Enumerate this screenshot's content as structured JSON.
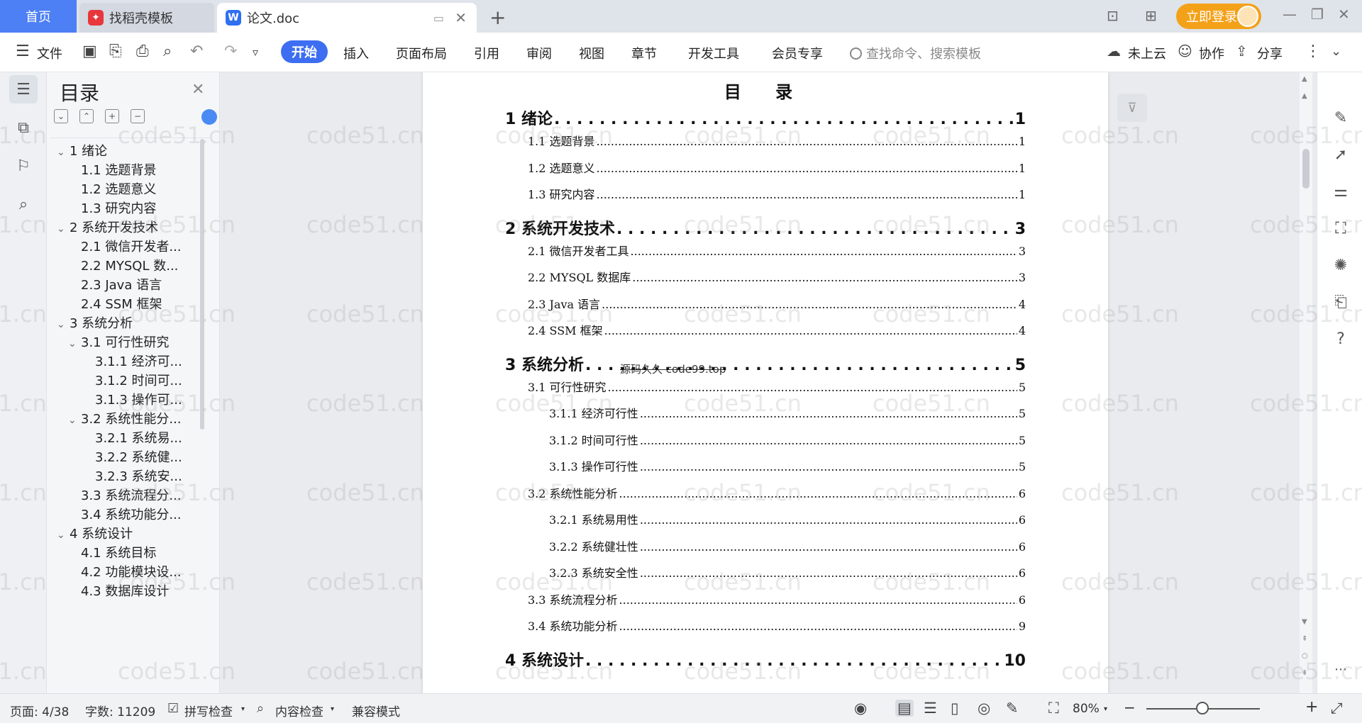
{
  "tabs": {
    "home": "首页",
    "tab1": {
      "label": "找稻壳模板",
      "icon": "docer-logo-icon"
    },
    "tab2": {
      "label": "论文.doc",
      "icon": "wps-writer-logo-icon"
    },
    "login": "立即登录"
  },
  "ribbon": {
    "file": "文件",
    "tabs": [
      "开始",
      "插入",
      "页面布局",
      "引用",
      "审阅",
      "视图",
      "章节",
      "开发工具",
      "会员专享"
    ],
    "search_placeholder": "查找命令、搜索模板",
    "cloud": "未上云",
    "collab": "协作",
    "share": "分享"
  },
  "toc_panel": {
    "title": "目录",
    "items": [
      {
        "label": "1  绪论",
        "expanded": true,
        "level": 1
      },
      {
        "label": "1.1  选题背景",
        "level": 2
      },
      {
        "label": "1.2  选题意义",
        "level": 2
      },
      {
        "label": "1.3  研究内容",
        "level": 2
      },
      {
        "label": "2  系统开发技术",
        "expanded": true,
        "level": 1
      },
      {
        "label": "2.1 微信开发者...",
        "level": 2
      },
      {
        "label": "2.2 MYSQL 数...",
        "level": 2
      },
      {
        "label": "2.3 Java 语言",
        "level": 2
      },
      {
        "label": "2.4 SSM 框架",
        "level": 2
      },
      {
        "label": "3  系统分析",
        "expanded": true,
        "level": 1
      },
      {
        "label": "3.1 可行性研究",
        "expanded": true,
        "level": 2
      },
      {
        "label": "3.1.1 经济可...",
        "level": 3
      },
      {
        "label": "3.1.2 时间可...",
        "level": 3
      },
      {
        "label": "3.1.3 操作可...",
        "level": 3
      },
      {
        "label": "3.2 系统性能分...",
        "expanded": true,
        "level": 2
      },
      {
        "label": "3.2.1 系统易...",
        "level": 3
      },
      {
        "label": "3.2.2 系统健...",
        "level": 3
      },
      {
        "label": "3.2.3 系统安...",
        "level": 3
      },
      {
        "label": "3.3  系统流程分...",
        "level": 2
      },
      {
        "label": "3.4 系统功能分...",
        "level": 2
      },
      {
        "label": "4  系统设计",
        "expanded": true,
        "level": 1
      },
      {
        "label": "4.1 系统目标",
        "level": 2
      },
      {
        "label": "4.2 功能模块设...",
        "level": 2
      },
      {
        "label": "4.3 数据库设计",
        "level": 2
      }
    ]
  },
  "document": {
    "title": "目 录",
    "inline_watermark": "源码久久 code99.top",
    "lines": [
      {
        "text": "1  绪论",
        "page": "1",
        "level": 1
      },
      {
        "text": "1.1  选题背景",
        "page": "1",
        "level": 2
      },
      {
        "text": "1.2  选题意义",
        "page": "1",
        "level": 2
      },
      {
        "text": "1.3  研究内容",
        "page": "1",
        "level": 2
      },
      {
        "text": "2  系统开发技术",
        "page": "3",
        "level": 1
      },
      {
        "text": "2.1 微信开发者工具",
        "page": "3",
        "level": 2
      },
      {
        "text": "2.2 MYSQL 数据库",
        "page": "3",
        "level": 2
      },
      {
        "text": "2.3 Java 语言",
        "page": "4",
        "level": 2
      },
      {
        "text": "2.4 SSM 框架",
        "page": "4",
        "level": 2
      },
      {
        "text": "3  系统分析",
        "page": "5",
        "level": 1
      },
      {
        "text": "3.1 可行性研究",
        "page": "5",
        "level": 2
      },
      {
        "text": "3.1.1 经济可行性",
        "page": "5",
        "level": 3
      },
      {
        "text": "3.1.2 时间可行性",
        "page": "5",
        "level": 3
      },
      {
        "text": "3.1.3 操作可行性",
        "page": "5",
        "level": 3
      },
      {
        "text": "3.2 系统性能分析",
        "page": "6",
        "level": 2
      },
      {
        "text": "3.2.1 系统易用性",
        "page": "6",
        "level": 3
      },
      {
        "text": "3.2.2 系统健壮性",
        "page": "6",
        "level": 3
      },
      {
        "text": "3.2.3 系统安全性",
        "page": "6",
        "level": 3
      },
      {
        "text": "3.3  系统流程分析",
        "page": "6",
        "level": 2
      },
      {
        "text": "3.4 系统功能分析",
        "page": "9",
        "level": 2
      },
      {
        "text": "4  系统设计",
        "page": "10",
        "level": 1
      }
    ]
  },
  "status": {
    "page": "页面: 4/38",
    "words": "字数: 11209",
    "spell": "拼写检查",
    "content_check": "内容检查",
    "compat": "兼容模式",
    "zoom": "80%"
  },
  "watermark_text": "code51.cn"
}
